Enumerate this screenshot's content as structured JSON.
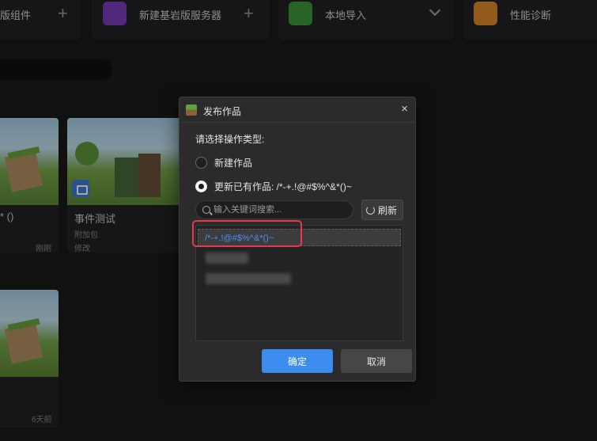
{
  "toolbar": {
    "item1_label": "版组件",
    "item2_label": "新建基岩版服务器",
    "item3_label": "本地导入",
    "item4_label": "性能诊断",
    "plus": "+"
  },
  "cards": [
    {
      "title": "* ()",
      "meta": "刚刚"
    },
    {
      "title": "事件测试",
      "type": "附加包",
      "status": "修改"
    },
    {
      "meta": "6天前"
    }
  ],
  "dialog": {
    "title": "发布作品",
    "close": "×",
    "prompt": "请选择操作类型:",
    "option_new": "新建作品",
    "option_update": "更新已有作品:  /*-+.!@#$%^&*()~",
    "search_placeholder": "输入关键词搜索...",
    "refresh_label": "刷新",
    "list_items": [
      "/*-+.!@#$%^&*()~"
    ],
    "confirm_label": "确定",
    "cancel_label": "取消"
  },
  "colors": {
    "accent": "#3d8cf0",
    "highlight": "#e5394d",
    "link": "#4f8ff0"
  }
}
